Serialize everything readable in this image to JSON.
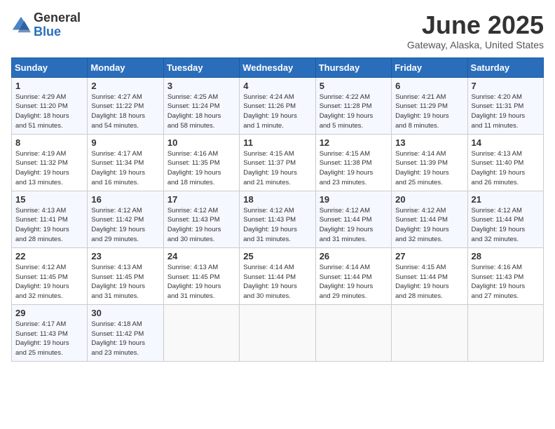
{
  "header": {
    "logo_general": "General",
    "logo_blue": "Blue",
    "month_title": "June 2025",
    "location": "Gateway, Alaska, United States"
  },
  "days_of_week": [
    "Sunday",
    "Monday",
    "Tuesday",
    "Wednesday",
    "Thursday",
    "Friday",
    "Saturday"
  ],
  "weeks": [
    [
      {
        "day": "1",
        "info": "Sunrise: 4:29 AM\nSunset: 11:20 PM\nDaylight: 18 hours\nand 51 minutes."
      },
      {
        "day": "2",
        "info": "Sunrise: 4:27 AM\nSunset: 11:22 PM\nDaylight: 18 hours\nand 54 minutes."
      },
      {
        "day": "3",
        "info": "Sunrise: 4:25 AM\nSunset: 11:24 PM\nDaylight: 18 hours\nand 58 minutes."
      },
      {
        "day": "4",
        "info": "Sunrise: 4:24 AM\nSunset: 11:26 PM\nDaylight: 19 hours\nand 1 minute."
      },
      {
        "day": "5",
        "info": "Sunrise: 4:22 AM\nSunset: 11:28 PM\nDaylight: 19 hours\nand 5 minutes."
      },
      {
        "day": "6",
        "info": "Sunrise: 4:21 AM\nSunset: 11:29 PM\nDaylight: 19 hours\nand 8 minutes."
      },
      {
        "day": "7",
        "info": "Sunrise: 4:20 AM\nSunset: 11:31 PM\nDaylight: 19 hours\nand 11 minutes."
      }
    ],
    [
      {
        "day": "8",
        "info": "Sunrise: 4:19 AM\nSunset: 11:32 PM\nDaylight: 19 hours\nand 13 minutes."
      },
      {
        "day": "9",
        "info": "Sunrise: 4:17 AM\nSunset: 11:34 PM\nDaylight: 19 hours\nand 16 minutes."
      },
      {
        "day": "10",
        "info": "Sunrise: 4:16 AM\nSunset: 11:35 PM\nDaylight: 19 hours\nand 18 minutes."
      },
      {
        "day": "11",
        "info": "Sunrise: 4:15 AM\nSunset: 11:37 PM\nDaylight: 19 hours\nand 21 minutes."
      },
      {
        "day": "12",
        "info": "Sunrise: 4:15 AM\nSunset: 11:38 PM\nDaylight: 19 hours\nand 23 minutes."
      },
      {
        "day": "13",
        "info": "Sunrise: 4:14 AM\nSunset: 11:39 PM\nDaylight: 19 hours\nand 25 minutes."
      },
      {
        "day": "14",
        "info": "Sunrise: 4:13 AM\nSunset: 11:40 PM\nDaylight: 19 hours\nand 26 minutes."
      }
    ],
    [
      {
        "day": "15",
        "info": "Sunrise: 4:13 AM\nSunset: 11:41 PM\nDaylight: 19 hours\nand 28 minutes."
      },
      {
        "day": "16",
        "info": "Sunrise: 4:12 AM\nSunset: 11:42 PM\nDaylight: 19 hours\nand 29 minutes."
      },
      {
        "day": "17",
        "info": "Sunrise: 4:12 AM\nSunset: 11:43 PM\nDaylight: 19 hours\nand 30 minutes."
      },
      {
        "day": "18",
        "info": "Sunrise: 4:12 AM\nSunset: 11:43 PM\nDaylight: 19 hours\nand 31 minutes."
      },
      {
        "day": "19",
        "info": "Sunrise: 4:12 AM\nSunset: 11:44 PM\nDaylight: 19 hours\nand 31 minutes."
      },
      {
        "day": "20",
        "info": "Sunrise: 4:12 AM\nSunset: 11:44 PM\nDaylight: 19 hours\nand 32 minutes."
      },
      {
        "day": "21",
        "info": "Sunrise: 4:12 AM\nSunset: 11:44 PM\nDaylight: 19 hours\nand 32 minutes."
      }
    ],
    [
      {
        "day": "22",
        "info": "Sunrise: 4:12 AM\nSunset: 11:45 PM\nDaylight: 19 hours\nand 32 minutes."
      },
      {
        "day": "23",
        "info": "Sunrise: 4:13 AM\nSunset: 11:45 PM\nDaylight: 19 hours\nand 31 minutes."
      },
      {
        "day": "24",
        "info": "Sunrise: 4:13 AM\nSunset: 11:45 PM\nDaylight: 19 hours\nand 31 minutes."
      },
      {
        "day": "25",
        "info": "Sunrise: 4:14 AM\nSunset: 11:44 PM\nDaylight: 19 hours\nand 30 minutes."
      },
      {
        "day": "26",
        "info": "Sunrise: 4:14 AM\nSunset: 11:44 PM\nDaylight: 19 hours\nand 29 minutes."
      },
      {
        "day": "27",
        "info": "Sunrise: 4:15 AM\nSunset: 11:44 PM\nDaylight: 19 hours\nand 28 minutes."
      },
      {
        "day": "28",
        "info": "Sunrise: 4:16 AM\nSunset: 11:43 PM\nDaylight: 19 hours\nand 27 minutes."
      }
    ],
    [
      {
        "day": "29",
        "info": "Sunrise: 4:17 AM\nSunset: 11:43 PM\nDaylight: 19 hours\nand 25 minutes."
      },
      {
        "day": "30",
        "info": "Sunrise: 4:18 AM\nSunset: 11:42 PM\nDaylight: 19 hours\nand 23 minutes."
      },
      null,
      null,
      null,
      null,
      null
    ]
  ]
}
